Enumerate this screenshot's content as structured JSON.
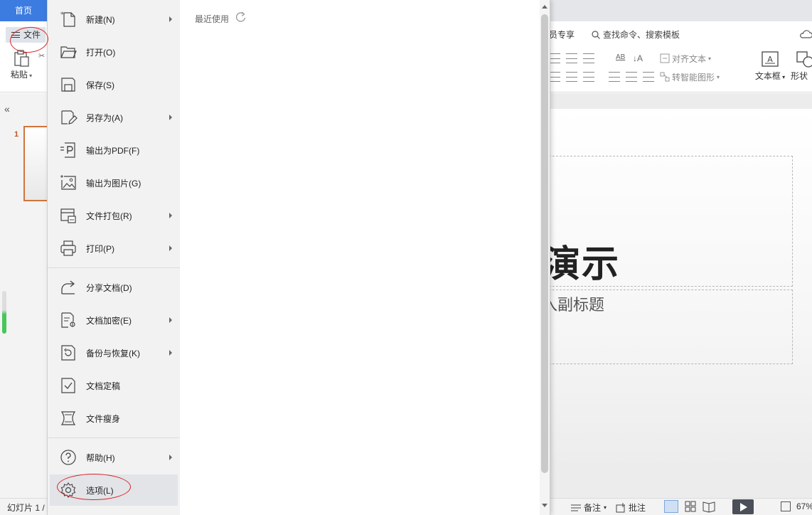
{
  "app": {
    "home_tab": "首页",
    "file_button": "文件",
    "member_tab": "员专享",
    "search_placeholder": "查找命令、搜索模板",
    "paste_label": "粘贴",
    "textbox_label": "文本框",
    "shape_label": "形状",
    "align_text_label": "对齐文本",
    "smartart_label": "转智能图形",
    "slide_number": "1",
    "slide_title": "演示",
    "slide_subtitle": "入副标题",
    "status": {
      "slide_counter": "幻灯片 1 /",
      "notes": "备注",
      "comments": "批注",
      "zoom": "67%"
    }
  },
  "file_menu": {
    "recent_label": "最近使用",
    "items": [
      {
        "label": "新建(N)",
        "icon": "new-file-icon",
        "submenu": true
      },
      {
        "label": "打开(O)",
        "icon": "folder-open-icon",
        "submenu": false
      },
      {
        "label": "保存(S)",
        "icon": "save-icon",
        "submenu": false
      },
      {
        "label": "另存为(A)",
        "icon": "save-as-icon",
        "submenu": true
      },
      {
        "label": "输出为PDF(F)",
        "icon": "export-pdf-icon",
        "submenu": false
      },
      {
        "label": "输出为图片(G)",
        "icon": "export-image-icon",
        "submenu": false
      },
      {
        "label": "文件打包(R)",
        "icon": "package-icon",
        "submenu": true
      },
      {
        "label": "打印(P)",
        "icon": "print-icon",
        "submenu": true
      },
      {
        "label": "分享文档(D)",
        "icon": "share-icon",
        "submenu": false
      },
      {
        "label": "文档加密(E)",
        "icon": "encrypt-icon",
        "submenu": true
      },
      {
        "label": "备份与恢复(K)",
        "icon": "backup-icon",
        "submenu": true
      },
      {
        "label": "文档定稿",
        "icon": "finalize-icon",
        "submenu": false
      },
      {
        "label": "文件瘦身",
        "icon": "slim-icon",
        "submenu": false
      },
      {
        "label": "帮助(H)",
        "icon": "help-icon",
        "submenu": true
      },
      {
        "label": "选项(L)",
        "icon": "gear-icon",
        "submenu": false
      }
    ]
  },
  "colors": {
    "home_tab_bg": "#3c7ce0",
    "menu_bg": "#f2f2f2",
    "annotation": "#d9242b",
    "slide_thumb_border": "#d0743b"
  }
}
